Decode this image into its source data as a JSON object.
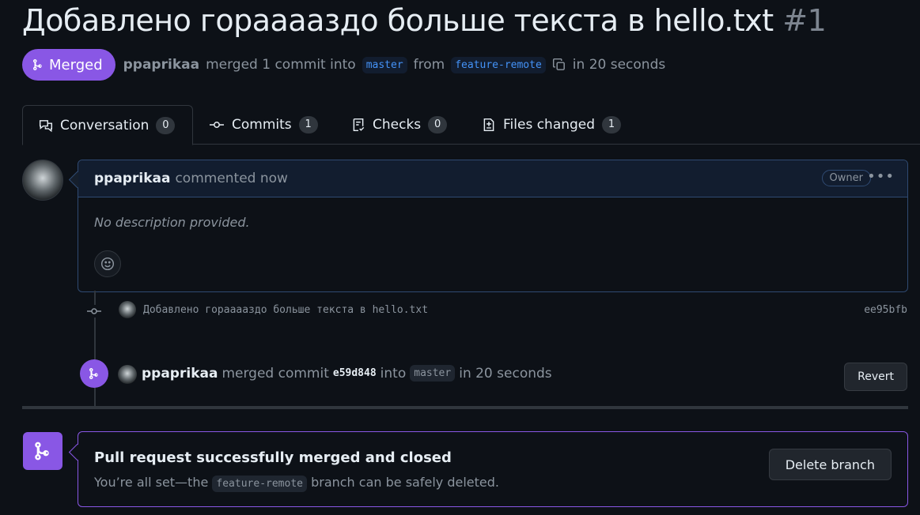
{
  "pr": {
    "title": "Добавлено горааааздо больше текста в hello.txt",
    "number": "#1",
    "state": "Merged",
    "author": "ppaprikaa",
    "summary_1": "merged 1 commit into",
    "base_branch": "master",
    "summary_2": "from",
    "head_branch": "feature-remote",
    "summary_3": "in 20 seconds"
  },
  "tabs": [
    {
      "label": "Conversation",
      "count": "0",
      "icon": "conversation-icon"
    },
    {
      "label": "Commits",
      "count": "1",
      "icon": "commit-icon"
    },
    {
      "label": "Checks",
      "count": "0",
      "icon": "checklist-icon"
    },
    {
      "label": "Files changed",
      "count": "1",
      "icon": "file-diff-icon"
    }
  ],
  "comment": {
    "author": "ppaprikaa",
    "action": "commented now",
    "role_badge": "Owner",
    "body": "No description provided."
  },
  "commit": {
    "message": "Добавлено горааааздо больше текста в hello.txt",
    "sha": "ee95bfb"
  },
  "merge_event": {
    "author": "ppaprikaa",
    "text_1": "merged commit",
    "sha": "e59d848",
    "text_2": "into",
    "branch": "master",
    "text_3": "in 20 seconds",
    "revert_label": "Revert"
  },
  "merged_box": {
    "title": "Pull request successfully merged and closed",
    "sub_1": "You’re all set—the",
    "branch": "feature-remote",
    "sub_2": "branch can be safely deleted.",
    "delete_label": "Delete branch"
  },
  "colors": {
    "background": "#0d1117",
    "merged_purple": "#8957e5",
    "link_blue": "#4493f8",
    "muted_text": "#8b949e"
  }
}
